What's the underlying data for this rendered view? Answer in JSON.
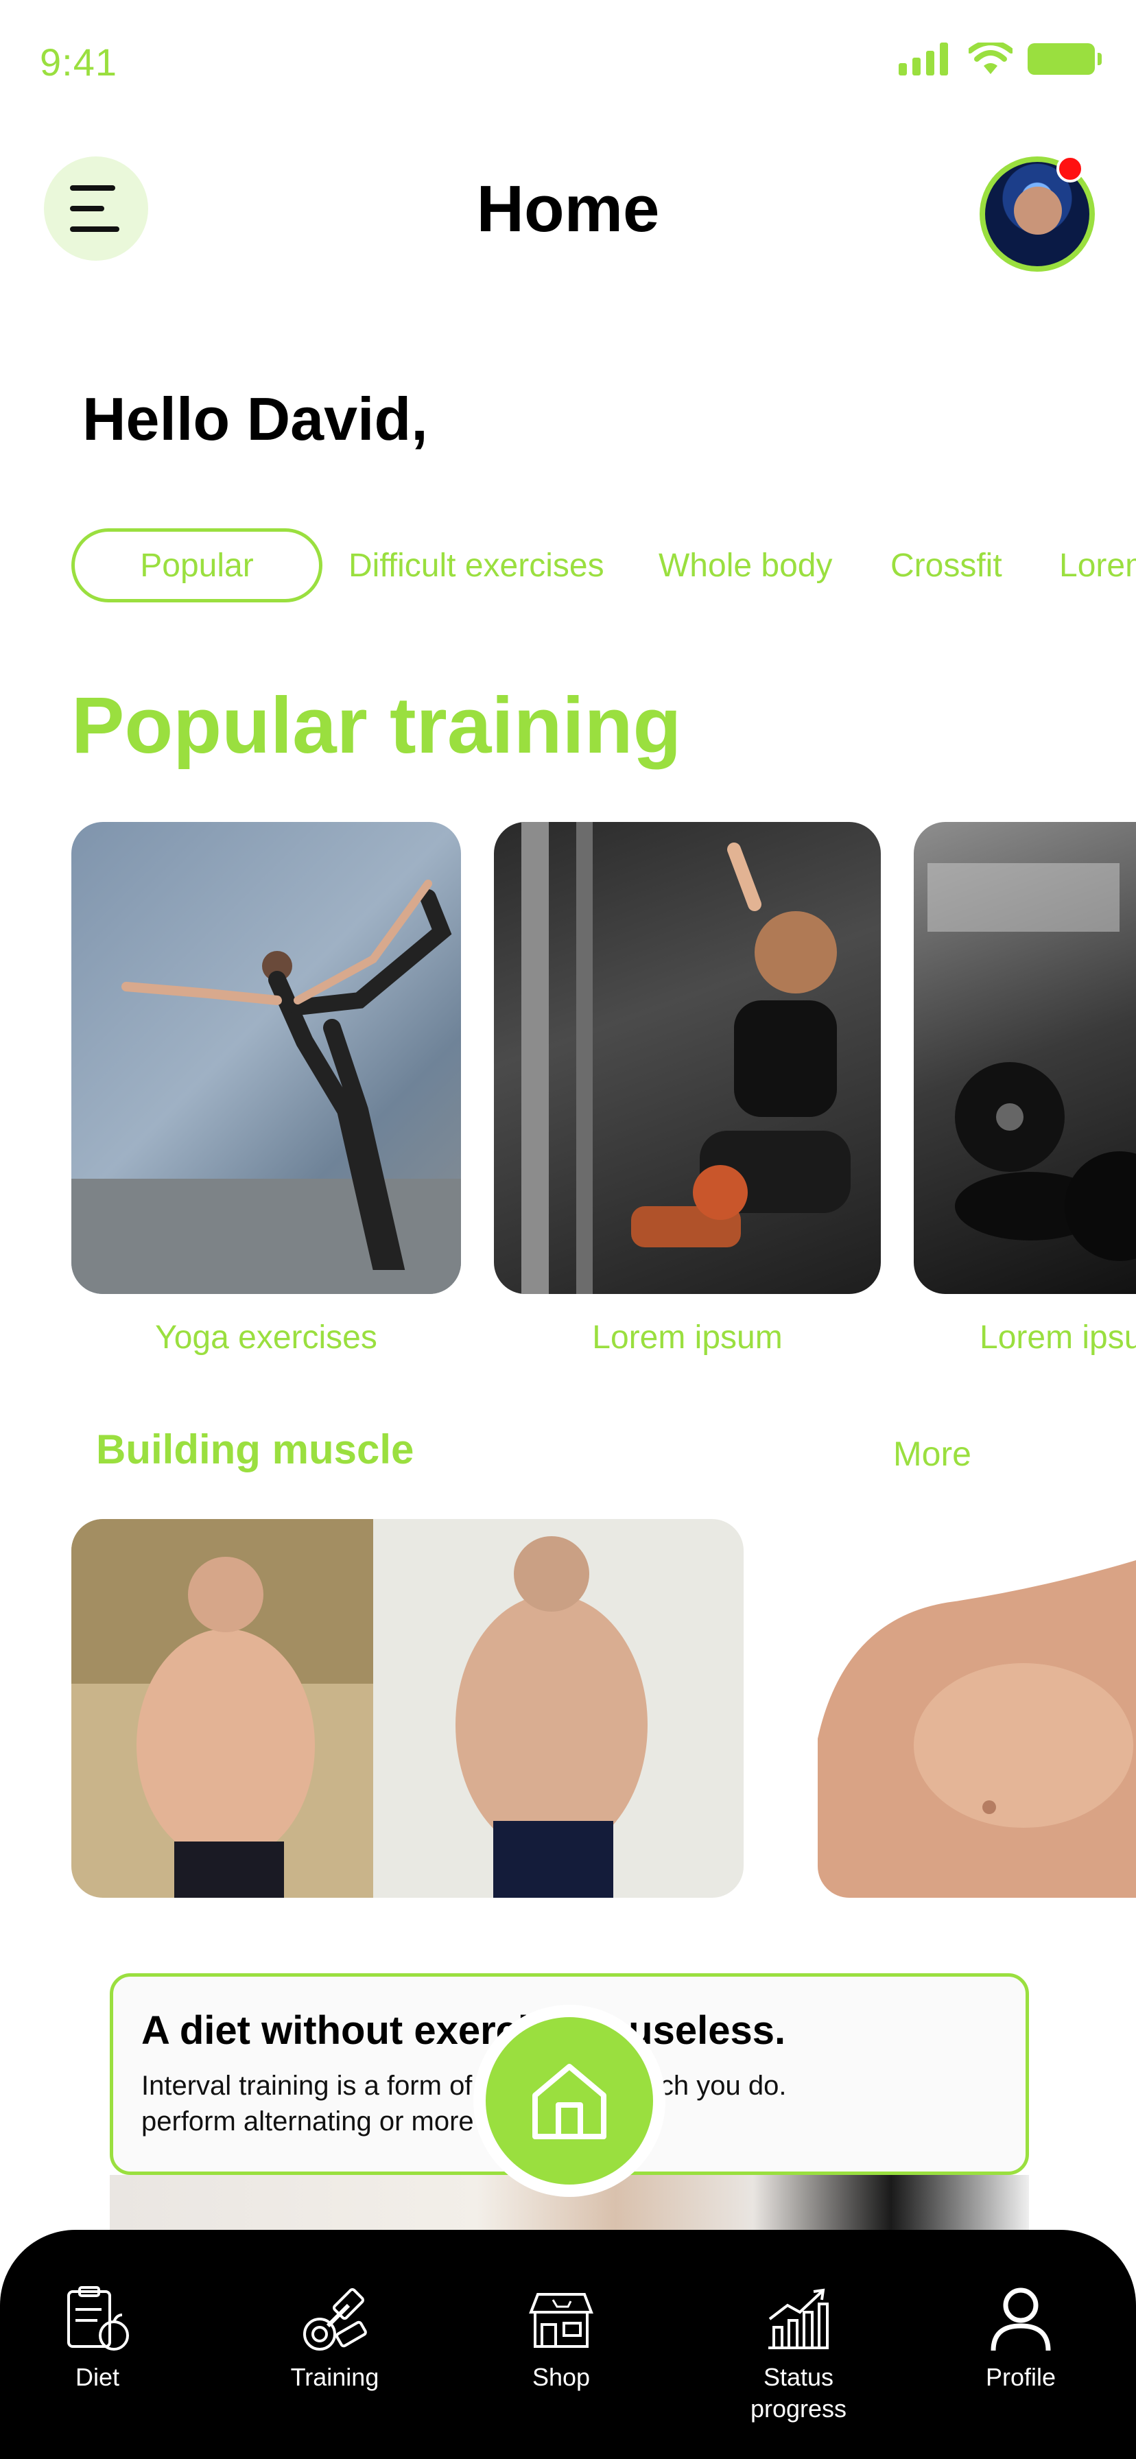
{
  "status_bar": {
    "time": "9:41"
  },
  "header": {
    "title": "Home"
  },
  "greeting": "Hello David,",
  "categories": [
    "Popular",
    "Difficult exercises",
    "Whole body",
    "Crossfit",
    "Lorem"
  ],
  "popular": {
    "title": "Popular training",
    "cards": [
      {
        "label": "Yoga exercises"
      },
      {
        "label": "Lorem ipsum"
      },
      {
        "label": "Lorem ipsum"
      }
    ]
  },
  "building_muscle": {
    "title": "Building muscle",
    "more": "More"
  },
  "diet_card": {
    "title": "A diet without exercise is useless.",
    "text_line1": "Interval training is a form of exercise in which you do.",
    "text_line2": "perform alternating or more"
  },
  "nav": {
    "items": [
      {
        "label": "Diet"
      },
      {
        "label": "Training"
      },
      {
        "label": "Shop"
      },
      {
        "label": "Status progress"
      },
      {
        "label": "Profile"
      }
    ]
  },
  "colors": {
    "accent": "#9ADF3F",
    "nav_bg": "#000000",
    "notification": "#FF1111"
  }
}
